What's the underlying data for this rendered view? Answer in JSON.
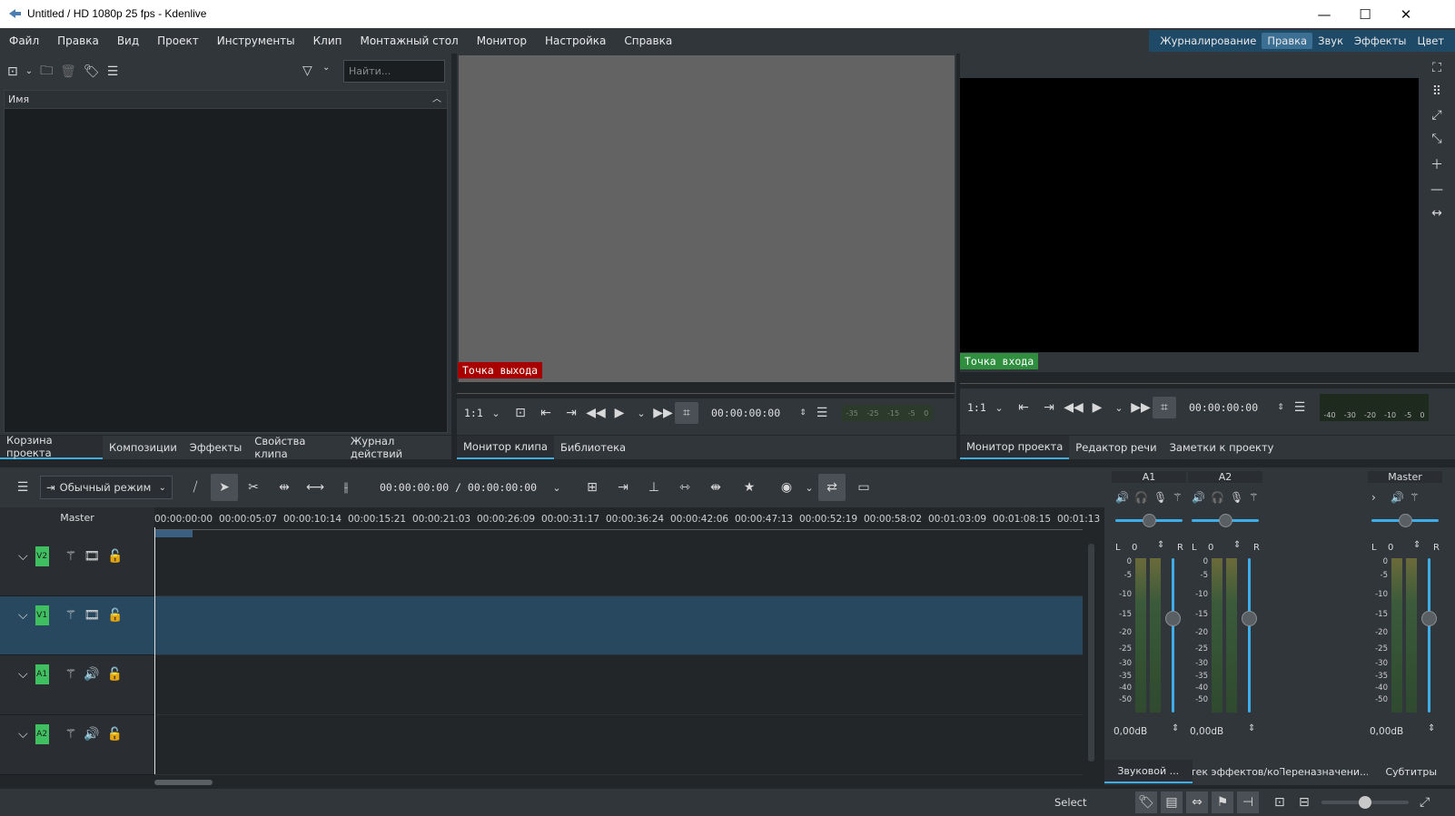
{
  "window": {
    "title": "Untitled / HD 1080p 25 fps - Kdenlive",
    "minimize": "—",
    "maximize": "☐",
    "close": "✕"
  },
  "menu": [
    "Файл",
    "Правка",
    "Вид",
    "Проект",
    "Инструменты",
    "Клип",
    "Монтажный стол",
    "Монитор",
    "Настройка",
    "Справка"
  ],
  "layouts": [
    {
      "label": "Журналирование",
      "active": false
    },
    {
      "label": "Правка",
      "active": true
    },
    {
      "label": "Звук",
      "active": false
    },
    {
      "label": "Эффекты",
      "active": false
    },
    {
      "label": "Цвет",
      "active": false
    }
  ],
  "bin": {
    "search_placeholder": "Найти...",
    "column_name": "Имя",
    "tabs": [
      {
        "label": "Корзина проекта",
        "active": true
      },
      {
        "label": "Композиции",
        "active": false
      },
      {
        "label": "Эффекты",
        "active": false
      },
      {
        "label": "Свойства клипа",
        "active": false
      },
      {
        "label": "Журнал действий",
        "active": false
      }
    ]
  },
  "clip_monitor": {
    "zone_label": "Точка выхода",
    "zoom": "1:1",
    "timecode": "00:00:00:00",
    "meter_labels": [
      "-35",
      "-25",
      "-15",
      "-5",
      "0"
    ],
    "tabs": [
      {
        "label": "Монитор клипа",
        "active": true
      },
      {
        "label": "Библиотека",
        "active": false
      }
    ]
  },
  "project_monitor": {
    "zone_label": "Точка входа",
    "zoom": "1:1",
    "timecode": "00:00:00:00",
    "meter_labels": [
      "-40",
      "-30",
      "-20",
      "-10",
      "-5",
      "0"
    ],
    "tabs": [
      {
        "label": "Монитор проекта",
        "active": true
      },
      {
        "label": "Редактор речи",
        "active": false
      },
      {
        "label": "Заметки к проекту",
        "active": false
      }
    ]
  },
  "timeline": {
    "mode": "Обычный режим",
    "position": "00:00:00:00 / 00:00:00:00",
    "master_label": "Master",
    "ruler": [
      "00:00:00:00",
      "00:00:05:07",
      "00:00:10:14",
      "00:00:15:21",
      "00:00:21:03",
      "00:00:26:09",
      "00:00:31:17",
      "00:00:36:24",
      "00:00:42:06",
      "00:00:47:13",
      "00:00:52:19",
      "00:00:58:02",
      "00:01:03:09",
      "00:01:08:15",
      "00:01:13"
    ],
    "tracks": [
      {
        "tag": "V2",
        "type": "video",
        "selected": false
      },
      {
        "tag": "V1",
        "type": "video",
        "selected": true
      },
      {
        "tag": "A1",
        "type": "audio",
        "selected": false
      },
      {
        "tag": "A2",
        "type": "audio",
        "selected": false
      }
    ]
  },
  "mixer": {
    "channels": [
      {
        "name": "A1",
        "balance": "0",
        "gain": "0,00dB"
      },
      {
        "name": "A2",
        "balance": "0",
        "gain": "0,00dB"
      },
      {
        "name": "Master",
        "balance": "0",
        "gain": "0,00dB"
      }
    ],
    "lr_left": "L",
    "lr_right": "R",
    "scale": [
      "0",
      "-5",
      "-10",
      "-15",
      "-20",
      "-25",
      "-30",
      "-35",
      "-40",
      "-50"
    ],
    "tabs": [
      {
        "label": "Звуковой ...",
        "active": true
      },
      {
        "label": "Стек эффектов/ко...",
        "active": false
      },
      {
        "label": "Переназначени...",
        "active": false
      },
      {
        "label": "Субтитры",
        "active": false
      }
    ]
  },
  "status": {
    "tool": "Select",
    "zoom_level": 0.5
  },
  "colors": {
    "accent": "#3daee9",
    "out_zone": "#a80000",
    "in_zone": "#2f8f3f",
    "track_tag": "#3fbf5f",
    "selected_track": "#28485f"
  }
}
